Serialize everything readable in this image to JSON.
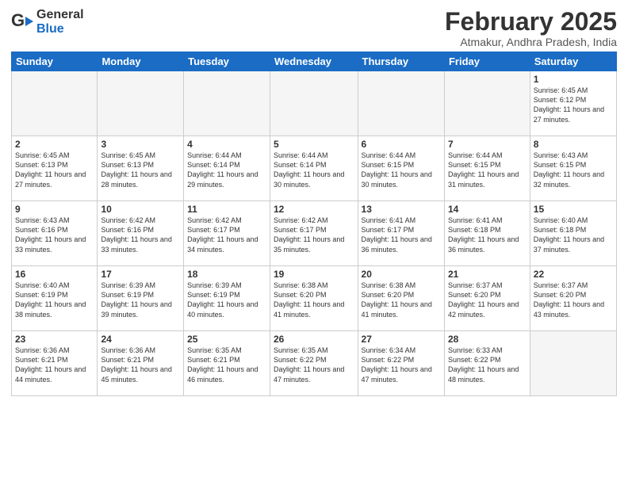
{
  "logo": {
    "general": "General",
    "blue": "Blue"
  },
  "title": "February 2025",
  "location": "Atmakur, Andhra Pradesh, India",
  "weekdays": [
    "Sunday",
    "Monday",
    "Tuesday",
    "Wednesday",
    "Thursday",
    "Friday",
    "Saturday"
  ],
  "weeks": [
    [
      {
        "day": "",
        "info": ""
      },
      {
        "day": "",
        "info": ""
      },
      {
        "day": "",
        "info": ""
      },
      {
        "day": "",
        "info": ""
      },
      {
        "day": "",
        "info": ""
      },
      {
        "day": "",
        "info": ""
      },
      {
        "day": "1",
        "info": "Sunrise: 6:45 AM\nSunset: 6:12 PM\nDaylight: 11 hours and 27 minutes."
      }
    ],
    [
      {
        "day": "2",
        "info": "Sunrise: 6:45 AM\nSunset: 6:13 PM\nDaylight: 11 hours and 27 minutes."
      },
      {
        "day": "3",
        "info": "Sunrise: 6:45 AM\nSunset: 6:13 PM\nDaylight: 11 hours and 28 minutes."
      },
      {
        "day": "4",
        "info": "Sunrise: 6:44 AM\nSunset: 6:14 PM\nDaylight: 11 hours and 29 minutes."
      },
      {
        "day": "5",
        "info": "Sunrise: 6:44 AM\nSunset: 6:14 PM\nDaylight: 11 hours and 30 minutes."
      },
      {
        "day": "6",
        "info": "Sunrise: 6:44 AM\nSunset: 6:15 PM\nDaylight: 11 hours and 30 minutes."
      },
      {
        "day": "7",
        "info": "Sunrise: 6:44 AM\nSunset: 6:15 PM\nDaylight: 11 hours and 31 minutes."
      },
      {
        "day": "8",
        "info": "Sunrise: 6:43 AM\nSunset: 6:15 PM\nDaylight: 11 hours and 32 minutes."
      }
    ],
    [
      {
        "day": "9",
        "info": "Sunrise: 6:43 AM\nSunset: 6:16 PM\nDaylight: 11 hours and 33 minutes."
      },
      {
        "day": "10",
        "info": "Sunrise: 6:42 AM\nSunset: 6:16 PM\nDaylight: 11 hours and 33 minutes."
      },
      {
        "day": "11",
        "info": "Sunrise: 6:42 AM\nSunset: 6:17 PM\nDaylight: 11 hours and 34 minutes."
      },
      {
        "day": "12",
        "info": "Sunrise: 6:42 AM\nSunset: 6:17 PM\nDaylight: 11 hours and 35 minutes."
      },
      {
        "day": "13",
        "info": "Sunrise: 6:41 AM\nSunset: 6:17 PM\nDaylight: 11 hours and 36 minutes."
      },
      {
        "day": "14",
        "info": "Sunrise: 6:41 AM\nSunset: 6:18 PM\nDaylight: 11 hours and 36 minutes."
      },
      {
        "day": "15",
        "info": "Sunrise: 6:40 AM\nSunset: 6:18 PM\nDaylight: 11 hours and 37 minutes."
      }
    ],
    [
      {
        "day": "16",
        "info": "Sunrise: 6:40 AM\nSunset: 6:19 PM\nDaylight: 11 hours and 38 minutes."
      },
      {
        "day": "17",
        "info": "Sunrise: 6:39 AM\nSunset: 6:19 PM\nDaylight: 11 hours and 39 minutes."
      },
      {
        "day": "18",
        "info": "Sunrise: 6:39 AM\nSunset: 6:19 PM\nDaylight: 11 hours and 40 minutes."
      },
      {
        "day": "19",
        "info": "Sunrise: 6:38 AM\nSunset: 6:20 PM\nDaylight: 11 hours and 41 minutes."
      },
      {
        "day": "20",
        "info": "Sunrise: 6:38 AM\nSunset: 6:20 PM\nDaylight: 11 hours and 41 minutes."
      },
      {
        "day": "21",
        "info": "Sunrise: 6:37 AM\nSunset: 6:20 PM\nDaylight: 11 hours and 42 minutes."
      },
      {
        "day": "22",
        "info": "Sunrise: 6:37 AM\nSunset: 6:20 PM\nDaylight: 11 hours and 43 minutes."
      }
    ],
    [
      {
        "day": "23",
        "info": "Sunrise: 6:36 AM\nSunset: 6:21 PM\nDaylight: 11 hours and 44 minutes."
      },
      {
        "day": "24",
        "info": "Sunrise: 6:36 AM\nSunset: 6:21 PM\nDaylight: 11 hours and 45 minutes."
      },
      {
        "day": "25",
        "info": "Sunrise: 6:35 AM\nSunset: 6:21 PM\nDaylight: 11 hours and 46 minutes."
      },
      {
        "day": "26",
        "info": "Sunrise: 6:35 AM\nSunset: 6:22 PM\nDaylight: 11 hours and 47 minutes."
      },
      {
        "day": "27",
        "info": "Sunrise: 6:34 AM\nSunset: 6:22 PM\nDaylight: 11 hours and 47 minutes."
      },
      {
        "day": "28",
        "info": "Sunrise: 6:33 AM\nSunset: 6:22 PM\nDaylight: 11 hours and 48 minutes."
      },
      {
        "day": "",
        "info": ""
      }
    ]
  ]
}
